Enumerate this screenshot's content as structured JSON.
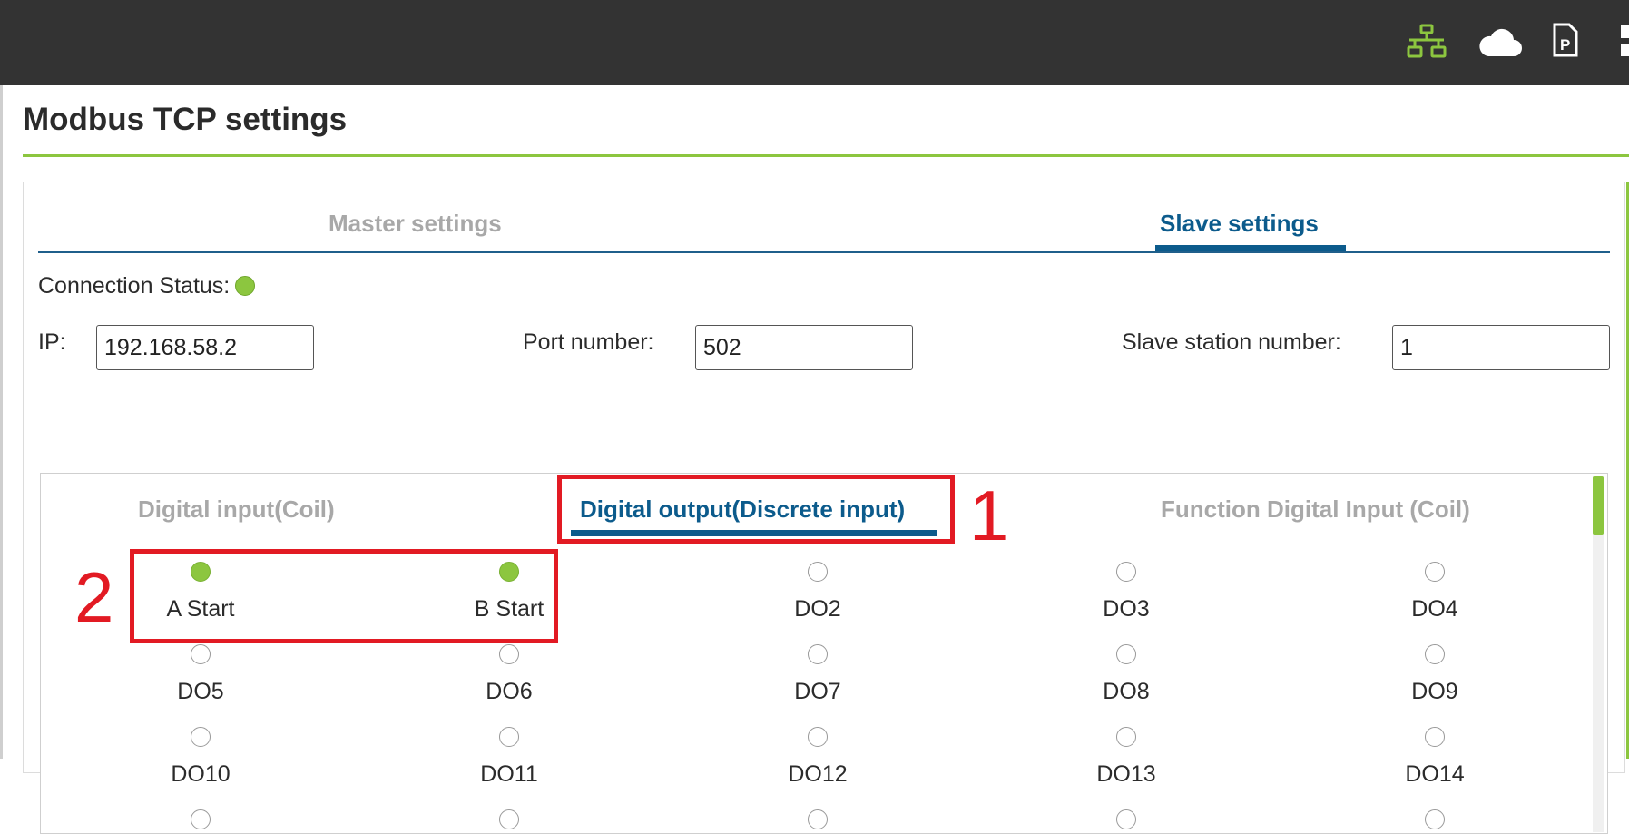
{
  "topbar": {
    "icons": [
      "network-icon",
      "cloud-icon",
      "pdf-file-icon",
      "menu-icon"
    ],
    "network_color": "#8cc63f"
  },
  "page": {
    "title": "Modbus TCP settings"
  },
  "tabs": [
    {
      "label": "Master settings",
      "active": false
    },
    {
      "label": "Slave settings",
      "active": true
    }
  ],
  "connection": {
    "label": "Connection Status:",
    "status_color": "#8cc63f"
  },
  "fields": {
    "ip_label": "IP:",
    "ip_value": "192.168.58.2",
    "port_label": "Port number:",
    "port_value": "502",
    "station_label": "Slave station number:",
    "station_value": "1"
  },
  "subtabs": [
    {
      "label": "Digital input(Coil)",
      "active": false
    },
    {
      "label": "Digital output(Discrete input)",
      "active": true
    },
    {
      "label": "Function Digital Input (Coil)",
      "active": false
    }
  ],
  "outputs": [
    {
      "label": "A Start",
      "on": true
    },
    {
      "label": "B Start",
      "on": true
    },
    {
      "label": "DO2",
      "on": false
    },
    {
      "label": "DO3",
      "on": false
    },
    {
      "label": "DO4",
      "on": false
    },
    {
      "label": "DO5",
      "on": false
    },
    {
      "label": "DO6",
      "on": false
    },
    {
      "label": "DO7",
      "on": false
    },
    {
      "label": "DO8",
      "on": false
    },
    {
      "label": "DO9",
      "on": false
    },
    {
      "label": "DO10",
      "on": false
    },
    {
      "label": "DO11",
      "on": false
    },
    {
      "label": "DO12",
      "on": false
    },
    {
      "label": "DO13",
      "on": false
    },
    {
      "label": "DO14",
      "on": false
    }
  ],
  "annotations": {
    "label_1": "1",
    "label_2": "2",
    "color": "#e21a23"
  }
}
